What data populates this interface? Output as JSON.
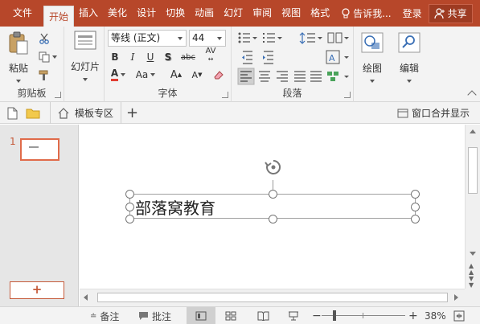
{
  "tabs": {
    "file": "文件",
    "home": "开始",
    "insert": "插入",
    "beautify": "美化",
    "design": "设计",
    "transitions": "切换",
    "animations": "动画",
    "slideshow": "幻灯",
    "review": "审阅",
    "view": "视图",
    "format": "格式",
    "tell_me": "告诉我...",
    "login": "登录",
    "share": "共享"
  },
  "ribbon": {
    "clipboard": {
      "paste": "粘贴",
      "label": "剪贴板"
    },
    "slides": {
      "slide": "幻灯片"
    },
    "font": {
      "font_name": "等线 (正文)",
      "font_size": "44",
      "bold": "B",
      "italic": "I",
      "underline": "U",
      "shadow": "S",
      "strike": "abc",
      "spacing": "AV",
      "color_a": "A",
      "case": "Aa",
      "grow": "A",
      "shrink": "A",
      "label": "字体"
    },
    "paragraph": {
      "label": "段落"
    },
    "drawing": {
      "label": "绘图"
    },
    "editing": {
      "label": "编辑"
    }
  },
  "quick_access": {
    "template_zone": "模板专区",
    "window_merge": "窗口合并显示"
  },
  "slides": [
    {
      "number": "1"
    }
  ],
  "slide_text": "部落窝教育",
  "status": {
    "notes": "备注",
    "comments": "批注",
    "zoom": "38%"
  },
  "colors": {
    "accent": "#b7472a",
    "thumb_border": "#e06b4a"
  }
}
